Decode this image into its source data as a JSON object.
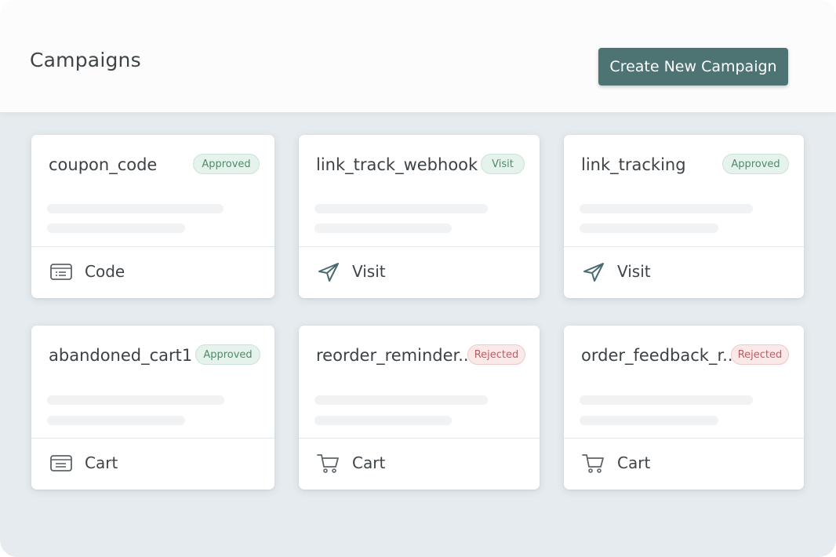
{
  "header": {
    "title": "Campaigns",
    "create_button": "Create New Campaign"
  },
  "colors": {
    "accent": "#4d7372",
    "approved": "#4f8a68",
    "rejected": "#c35a5e",
    "background": "#e5ebee"
  },
  "campaigns": [
    {
      "name": "coupon_code",
      "status": "Approved",
      "type_label": "Code",
      "type_icon": "coupon-icon"
    },
    {
      "name": "link_track_webhook",
      "status": "Visit",
      "type_label": "Visit",
      "type_icon": "send-icon"
    },
    {
      "name": "link_tracking",
      "status": "Approved",
      "type_label": "Visit",
      "type_icon": "send-icon"
    },
    {
      "name": "abandoned_cart1",
      "status": "Approved",
      "type_label": "Cart",
      "type_icon": "coupon-icon"
    },
    {
      "name": "reorder_reminder...",
      "status": "Rejected",
      "type_label": "Cart",
      "type_icon": "cart-icon"
    },
    {
      "name": "order_feedback_r...",
      "status": "Rejected",
      "type_label": "Cart",
      "type_icon": "cart-icon"
    }
  ]
}
